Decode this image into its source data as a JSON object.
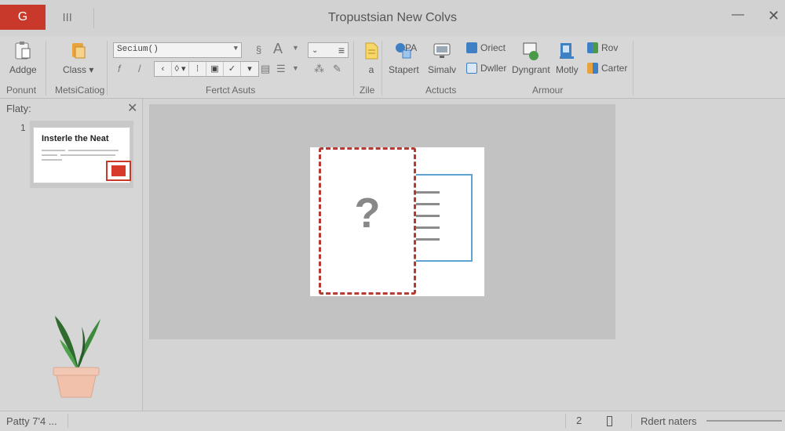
{
  "titlebar": {
    "app_button": "G",
    "qat": "lll",
    "title": "Tropustsian New Colvs",
    "minimize": "—",
    "close": "✕"
  },
  "ribbon": {
    "groups": {
      "g1": "Ponunt",
      "g2": "MetsiCatiog",
      "g3": "Fertct Asuts",
      "g4": "Zile",
      "g5": "Actucts",
      "g6": "Armour"
    },
    "adobe": "Addge",
    "class": "Class",
    "font_name": "Secium()",
    "file_btn": "a",
    "stapert": "Stapert",
    "simal": "Simalv",
    "oriect": "Oriect",
    "dwller": "Dwller",
    "dyngrant": "Dyngrant",
    "motly": "Motly",
    "rov": "Rov",
    "carter": "Carter",
    "pa": "PA",
    "colors": {
      "accent": "#c9392b",
      "blue": "#3f7fc4",
      "green": "#4a9a4a",
      "orange": "#e8a33d"
    }
  },
  "leftpane": {
    "title": "Flaty:",
    "close": "✕",
    "slide_num": "1",
    "thumb_title": "Insterle the Neat"
  },
  "canvas": {
    "placeholder": "?"
  },
  "statusbar": {
    "left": "Patty 7'4 ...",
    "page": "2",
    "zoom_label": "Rdert naters"
  }
}
